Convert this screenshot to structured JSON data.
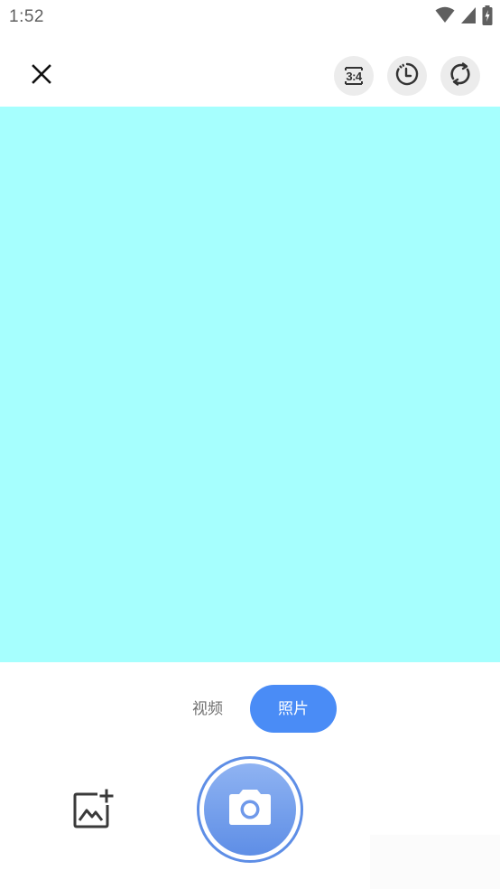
{
  "status_bar": {
    "time": "1:52",
    "icons": [
      "wifi-icon",
      "cellular-signal-icon",
      "battery-charging-icon"
    ]
  },
  "top_bar": {
    "close_icon": "close-icon",
    "aspect_ratio_label": "3:4",
    "timer_icon": "timer-icon",
    "switch_camera_icon": "switch-camera-icon"
  },
  "preview": {
    "background_color": "#a6fffe"
  },
  "bottom": {
    "modes": [
      {
        "label": "视频",
        "active": false
      },
      {
        "label": "照片",
        "active": true
      }
    ],
    "gallery_icon": "add-photo-icon",
    "shutter_icon": "camera-icon"
  },
  "colors": {
    "accent": "#4a8cf6",
    "shutter_gradient_top": "#8fb3f2",
    "shutter_gradient_bottom": "#5e8ee6",
    "preview": "#a6fffe"
  }
}
